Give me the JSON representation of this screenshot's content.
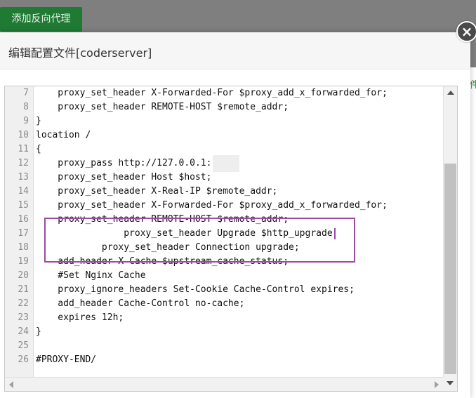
{
  "page": {
    "add_proxy_button": "添加反向代理",
    "right_edge_char": "件"
  },
  "dialog": {
    "title": "编辑配置文件[coderserver]",
    "close_symbol": "×"
  },
  "editor": {
    "lines": [
      {
        "num": "7",
        "code": "    proxy_set_header X-Forwarded-For $proxy_add_x_forwarded_for;"
      },
      {
        "num": "8",
        "code": "    proxy_set_header REMOTE-HOST $remote_addr;"
      },
      {
        "num": "9",
        "code": "}"
      },
      {
        "num": "10",
        "code": "location /"
      },
      {
        "num": "11",
        "code": "{"
      },
      {
        "num": "12",
        "code": "    proxy_pass http://127.0.0.1:"
      },
      {
        "num": "13",
        "code": "    proxy_set_header Host $host;"
      },
      {
        "num": "14",
        "code": "    proxy_set_header X-Real-IP $remote_addr;"
      },
      {
        "num": "15",
        "code": "    proxy_set_header X-Forwarded-For $proxy_add_x_forwarded_for;"
      },
      {
        "num": "16",
        "code": "    proxy_set_header REMOTE-HOST $remote_addr;"
      },
      {
        "num": "17",
        "code": "                proxy_set_header Upgrade $http_upgrade"
      },
      {
        "num": "18",
        "code": "            proxy_set_header Connection upgrade;"
      },
      {
        "num": "19",
        "code": "    add_header X-Cache $upstream_cache_status;"
      },
      {
        "num": "20",
        "code": "    #Set Nginx Cache"
      },
      {
        "num": "21",
        "code": "    proxy_ignore_headers Set-Cookie Cache-Control expires;"
      },
      {
        "num": "22",
        "code": "    add_header Cache-Control no-cache;"
      },
      {
        "num": "23",
        "code": "    expires 12h;"
      },
      {
        "num": "24",
        "code": "}"
      },
      {
        "num": "25",
        "code": ""
      },
      {
        "num": "26",
        "code": "#PROXY-END/"
      }
    ]
  },
  "colors": {
    "button_green": "#1f7a34",
    "highlight_border": "#9b4aa6"
  },
  "icons": {
    "close": "close-icon",
    "scroll_up": "chevron-up-icon",
    "scroll_down": "chevron-down-icon",
    "scroll_left": "chevron-left-icon",
    "scroll_right": "chevron-right-icon"
  }
}
